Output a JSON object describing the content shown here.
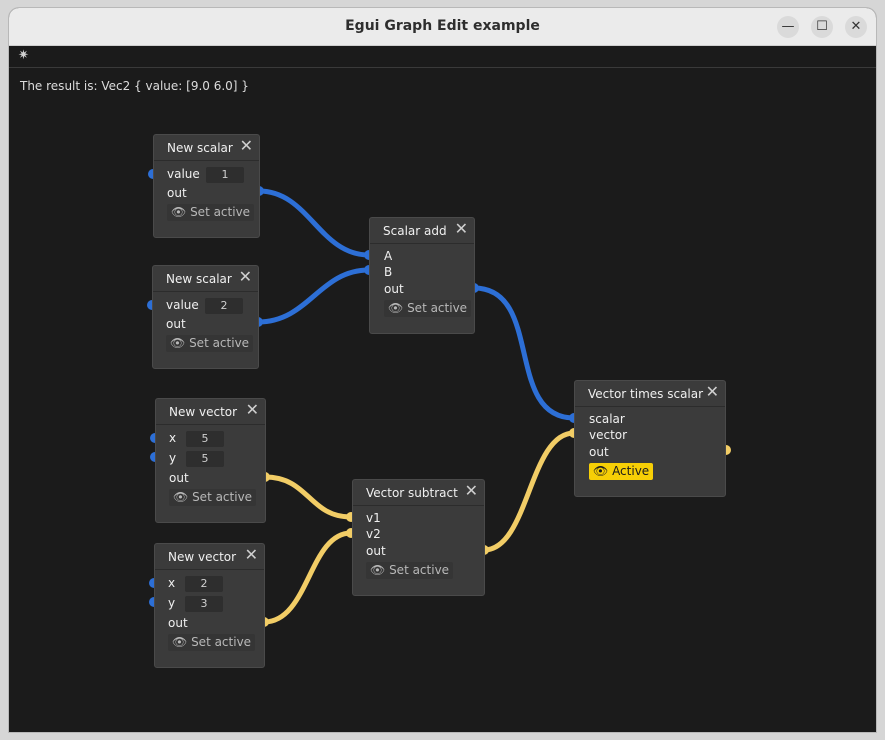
{
  "window": {
    "title": "Egui Graph Edit example",
    "controls": {
      "minimize": "—",
      "maximize": "☐",
      "close": "✕"
    }
  },
  "menubar": {
    "theme_icon": "✷"
  },
  "result_text": "The result is: Vec2 { value: [9.0 6.0] }",
  "icons": {
    "close": "✕",
    "eye": "👁"
  },
  "labels": {
    "set_active": "Set active",
    "active": "Active"
  },
  "colors": {
    "scalar_wire": "#2d6fd6",
    "vector_wire": "#f2cd66",
    "active_badge": "#f7cf06"
  },
  "nodes": {
    "scalar1": {
      "title": "New scalar",
      "param": "value",
      "value": "1",
      "output": "out"
    },
    "scalar2": {
      "title": "New scalar",
      "param": "value",
      "value": "2",
      "output": "out"
    },
    "scalar_add": {
      "title": "Scalar add",
      "input_a": "A",
      "input_b": "B",
      "output": "out"
    },
    "vector1": {
      "title": "New vector",
      "x_label": "x",
      "x_value": "5",
      "y_label": "y",
      "y_value": "5",
      "output": "out"
    },
    "vector2": {
      "title": "New vector",
      "x_label": "x",
      "x_value": "2",
      "y_label": "y",
      "y_value": "3",
      "output": "out"
    },
    "vector_subtract": {
      "title": "Vector subtract",
      "input_1": "v1",
      "input_2": "v2",
      "output": "out"
    },
    "vector_times_scalar": {
      "title": "Vector times scalar",
      "input_scalar": "scalar",
      "input_vector": "vector",
      "output": "out"
    }
  }
}
